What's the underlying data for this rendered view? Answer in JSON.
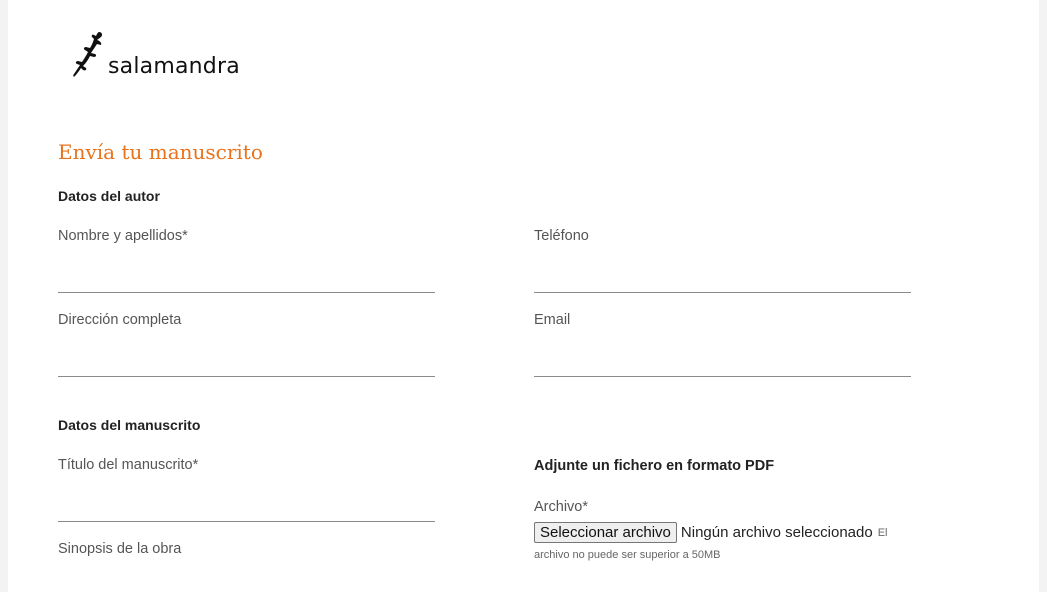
{
  "brand": {
    "name": "salamandra",
    "logo_icon": "salamander-icon"
  },
  "form": {
    "title": "Envía tu manuscrito",
    "author_section": "Datos del autor",
    "fields": {
      "name": {
        "label": "Nombre y apellidos*",
        "value": ""
      },
      "phone": {
        "label": "Teléfono",
        "value": ""
      },
      "address": {
        "label": "Dirección completa",
        "value": ""
      },
      "email": {
        "label": "Email",
        "value": ""
      },
      "manuscript_title": {
        "label": "Título del manuscrito*",
        "value": ""
      },
      "synopsis": {
        "label": "Sinopsis de la obra"
      }
    },
    "manuscript_section": "Datos del manuscrito",
    "attachment": {
      "heading": "Adjunte un fichero en formato PDF",
      "label": "Archivo*",
      "button": "Seleccionar archivo",
      "status": "Ningún archivo seleccionado",
      "hint_part1": "El",
      "hint_part2": "archivo no puede ser superior a 50MB"
    }
  },
  "colors": {
    "accent": "#e8731c",
    "background": "#ffffff",
    "underline": "#8a8a8a"
  }
}
